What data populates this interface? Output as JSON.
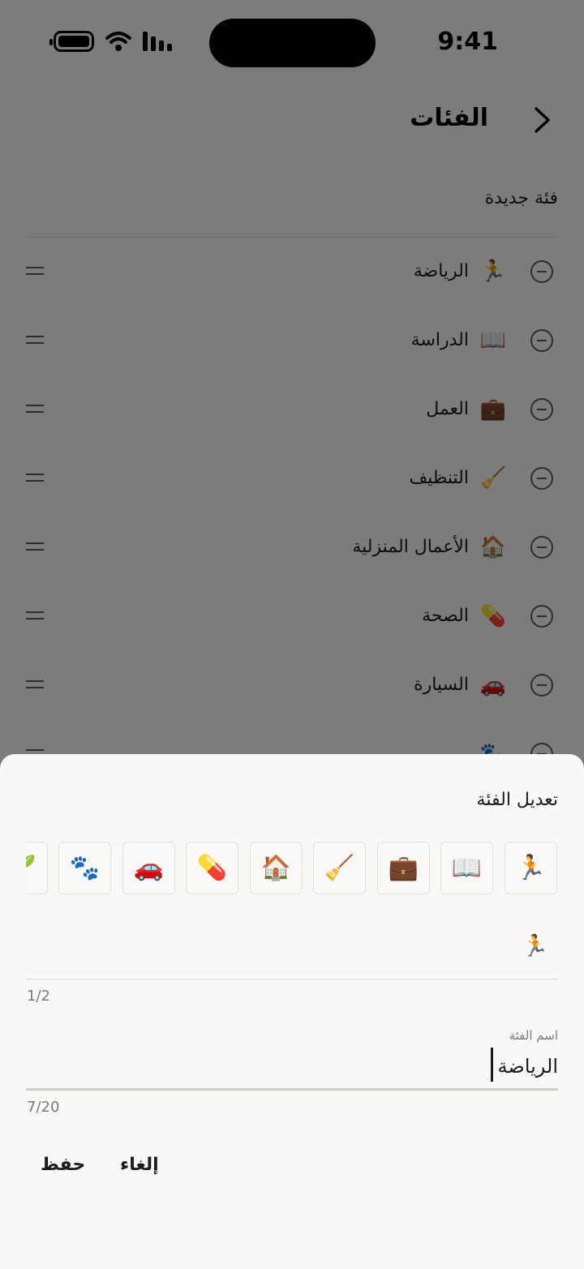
{
  "status_bar": {
    "time": "9:41"
  },
  "header": {
    "title": "الفئات"
  },
  "new_category_label": "فئة جديدة",
  "categories": [
    {
      "emoji": "🏃",
      "label": "الرياضة"
    },
    {
      "emoji": "📖",
      "label": "الدراسة"
    },
    {
      "emoji": "💼",
      "label": "العمل"
    },
    {
      "emoji": "🧹",
      "label": "التنظيف"
    },
    {
      "emoji": "🏠",
      "label": "الأعمال المنزلية"
    },
    {
      "emoji": "💊",
      "label": "الصحة"
    },
    {
      "emoji": "🚗",
      "label": "السيارة"
    }
  ],
  "sheet": {
    "title": "تعديل الفئة",
    "emoji_options": [
      "🏃",
      "📖",
      "💼",
      "🧹",
      "🏠",
      "💊",
      "🚗",
      "🐾",
      "🌱"
    ],
    "selected_emoji": "🏃",
    "emoji_counter": "1/2",
    "name_label": "اسم الفئة",
    "name_value": "الرياضة",
    "name_counter": "7/20",
    "cancel_label": "إلغاء",
    "save_label": "حفظ"
  }
}
